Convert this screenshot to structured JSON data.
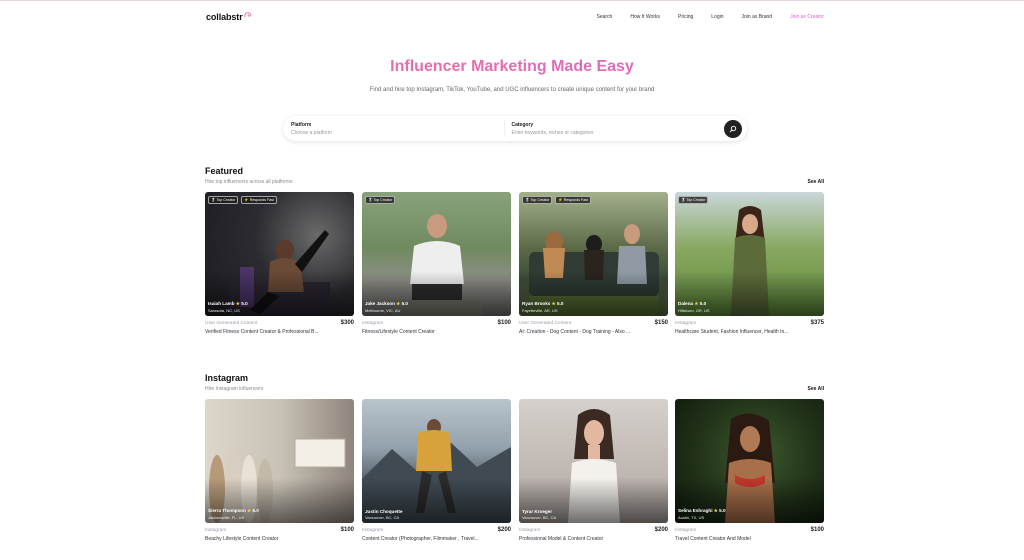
{
  "header": {
    "logo": "collabstr",
    "nav": [
      "Search",
      "How It Works",
      "Pricing",
      "Login",
      "Join as Brand",
      "Join as Creator"
    ]
  },
  "hero": {
    "title": "Influencer Marketing Made Easy",
    "subtitle": "Find and hire top Instagram, TikTok, YouTube, and UGC influencers to create unique content for your brand"
  },
  "search": {
    "platform_label": "Platform",
    "platform_placeholder": "Choose a platform",
    "category_label": "Category",
    "category_placeholder": "Enter keywords, niches or categories"
  },
  "featured": {
    "title": "Featured",
    "subtitle": "Hire top influencers across all platforms",
    "see_all": "See All",
    "cards": [
      {
        "badges": [
          "Top Creator",
          "Responds Fast"
        ],
        "name": "Isaiah Lamb",
        "rating": "5.0",
        "location": "Sarasota, NC, US",
        "platform": "User Generated Content",
        "price": "$300",
        "desc": "Verified Fitness Content Creator & Professional B..."
      },
      {
        "badges": [
          "Top Creator"
        ],
        "name": "Jake Jackson",
        "rating": "5.0",
        "location": "Melbourne, VIC, AU",
        "platform": "Instagram",
        "price": "$100",
        "desc": "Fitness/Lifestyle Content Creator"
      },
      {
        "badges": [
          "Top Creator",
          "Responds Fast"
        ],
        "name": "Ryan Brooks",
        "rating": "5.0",
        "location": "Fayetteville, AR, US",
        "platform": "User Generated Content",
        "price": "$150",
        "desc": "AI: Creation - Dog Content - Dog Training - Also ..."
      },
      {
        "badges": [
          "Top Creator"
        ],
        "name": "Dalena",
        "rating": "5.0",
        "location": "Hillsboro, OR, US",
        "platform": "Instagram",
        "price": "$375",
        "desc": "Healthcare Student, Fashion Influencer, Health In..."
      }
    ]
  },
  "instagram": {
    "title": "Instagram",
    "subtitle": "Hire Instagram influencers",
    "see_all": "See All",
    "cards": [
      {
        "badges": [],
        "name": "Sierra Thompson",
        "rating": "5.0",
        "location": "Jacksonville, FL, US",
        "platform": "Instagram",
        "price": "$100",
        "desc": "Beachy Lifestyle Content Creator"
      },
      {
        "badges": [],
        "name": "Justin Choquette",
        "rating": "",
        "location": "Vancouver, BC, CA",
        "platform": "Instagram",
        "price": "$200",
        "desc": "Content Creator (Photographer, Filmmaker , Travel..."
      },
      {
        "badges": [],
        "name": "Tyrar Kroeger",
        "rating": "",
        "location": "Vancouver, BC, CA",
        "platform": "Instagram",
        "price": "$200",
        "desc": "Professional Model & Content Creator"
      },
      {
        "badges": [],
        "name": "Selina Eshraghi",
        "rating": "5.0",
        "location": "Austin, TX, US",
        "platform": "Instagram",
        "price": "$100",
        "desc": "Travel Content Creator And Model"
      }
    ]
  },
  "colors": {
    "accent": "#e55ad0",
    "gradient_start": "#f2728c",
    "gradient_end": "#c65fe0",
    "star": "#ffc93c"
  },
  "icons": {
    "search_button": "search-icon",
    "badge_top": "ribbon-icon",
    "badge_fast": "bolt-icon",
    "rating": "star-icon"
  }
}
